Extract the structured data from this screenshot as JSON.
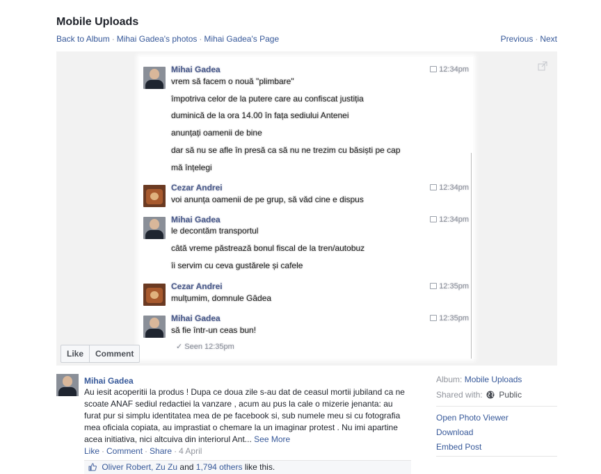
{
  "header": {
    "title": "Mobile Uploads",
    "crumbs": [
      {
        "label": "Back to Album"
      },
      {
        "label": "Mihai Gadea's photos"
      },
      {
        "label": "Mihai Gadea's Page"
      }
    ],
    "separator": "·",
    "previous_label": "Previous",
    "next_label": "Next"
  },
  "photo": {
    "messages": [
      {
        "author": "Mihai Gadea",
        "time": "12:34pm",
        "avatar": "mihai",
        "lines": [
          "vrem să facem o nouă \"plimbare\"",
          "împotriva celor de la putere care au confiscat justiția",
          "duminică de la ora 14.00 în fața sediului Antenei",
          "anunțați oamenii de bine",
          "dar să nu se afle în presă ca să nu ne trezim cu băsiști pe cap",
          "mă înțelegi"
        ]
      },
      {
        "author": "Cezar Andrei",
        "time": "12:34pm",
        "avatar": "cezar",
        "lines": [
          "voi anunța oamenii de pe grup, să văd cine e dispus"
        ]
      },
      {
        "author": "Mihai Gadea",
        "time": "12:34pm",
        "avatar": "mihai",
        "lines": [
          "le decontăm transportul",
          "câtă vreme păstrează bonul fiscal de la tren/autobuz",
          "îi servim cu ceva gustărele și cafele"
        ]
      },
      {
        "author": "Cezar Andrei",
        "time": "12:35pm",
        "avatar": "cezar",
        "lines": [
          "mulțumim, domnule Gâdea"
        ]
      },
      {
        "author": "Mihai Gadea",
        "time": "12:35pm",
        "avatar": "mihai",
        "lines": [
          "să fie într-un ceas bun!"
        ]
      }
    ],
    "seen": "✓ Seen 12:35pm",
    "like_label": "Like",
    "comment_label": "Comment"
  },
  "post": {
    "author": "Mihai Gadea",
    "text": "Au iesit acoperitii la produs ! Dupa ce doua zile s-au dat de ceasul mortii jubiland ca ne scoate ANAF sediul redactiei la vanzare , acum au pus la cale o mizerie jenanta: au furat pur si simplu identitatea mea de pe facebook si, sub numele meu si cu fotografia mea oficiala copiata, au imprastiat o chemare la un imaginar protest . Nu imi apartine acea initiativa, nici altcuiva din interiorul Ant...",
    "see_more": "See More",
    "actions": {
      "like": "Like",
      "comment": "Comment",
      "share": "Share",
      "date": "4 April"
    },
    "likes": {
      "names": "Oliver Robert, Zu Zu",
      "and": "and",
      "others": "1,794 others",
      "suffix": "like this."
    }
  },
  "side": {
    "album_label": "Album:",
    "album_value": "Mobile Uploads",
    "shared_label": "Shared with:",
    "shared_value": "Public",
    "menu": [
      "Open Photo Viewer",
      "Download",
      "Embed Post"
    ]
  }
}
